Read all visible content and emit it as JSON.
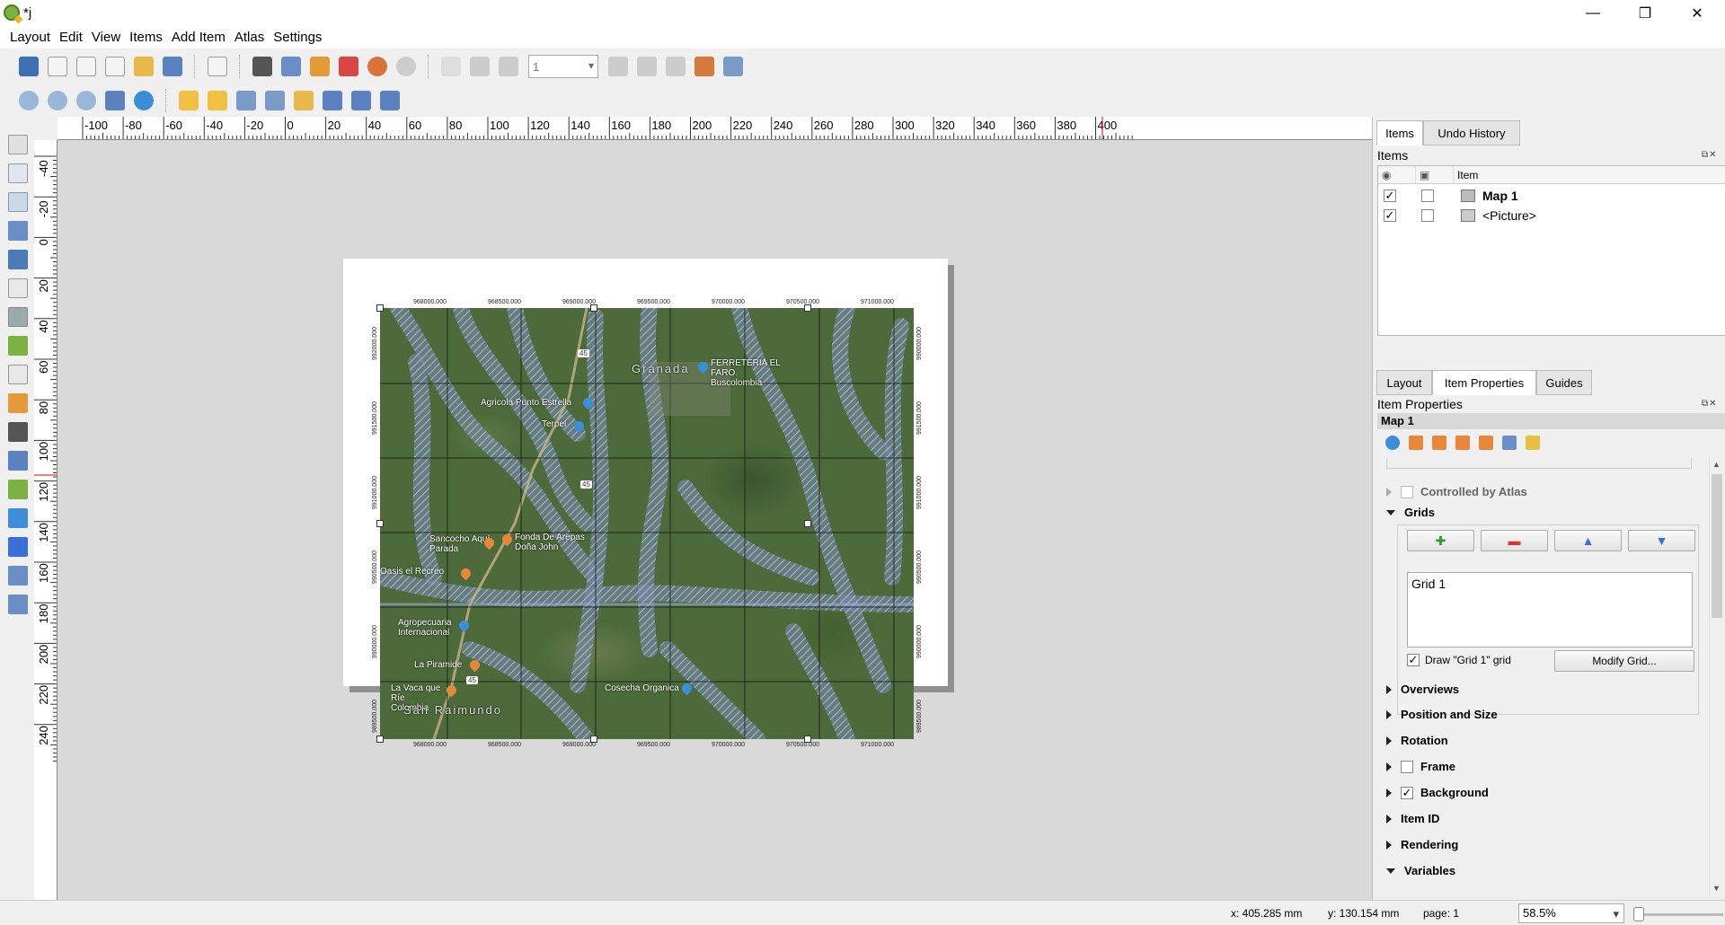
{
  "window": {
    "title": "*j",
    "minimize": "—",
    "maximize": "❐",
    "close": "✕"
  },
  "menu": [
    "Layout",
    "Edit",
    "View",
    "Items",
    "Add Item",
    "Atlas",
    "Settings"
  ],
  "toolbar": {
    "page_value": "1"
  },
  "ruler_top": [
    "-100",
    "-80",
    "-60",
    "-40",
    "-20",
    "0",
    "20",
    "40",
    "60",
    "80",
    "100",
    "120",
    "140",
    "160",
    "180",
    "200",
    "220",
    "240",
    "260",
    "280",
    "300",
    "320",
    "340",
    "360",
    "380",
    "400"
  ],
  "ruler_left": [
    "-40",
    "-20",
    "0",
    "20",
    "40",
    "60",
    "80",
    "100",
    "120",
    "140",
    "160",
    "180",
    "200",
    "220",
    "240"
  ],
  "map": {
    "top_coords": [
      "968000.000",
      "968500.000",
      "969000.000",
      "969500.000",
      "970000.000",
      "970500.000",
      "971000.000"
    ],
    "left_coords": [
      "992000.000",
      "991500.000",
      "991000.000",
      "990500.000",
      "990000.000",
      "989500.000"
    ],
    "right_coords": [
      "990000.000",
      "991500.000",
      "991000.000",
      "990500.000",
      "990000.000",
      "989500.000"
    ],
    "labels": {
      "granada": "Granada",
      "ferreteria": "FERRETERIA EL FARO. Buscolombia",
      "agricola": "Agricola Punto Estrella",
      "terpel": "Terpel",
      "sancocho": "Sancocho Aquí Parada",
      "arepas": "Fonda De Arepas Doña John",
      "recreo": "Oasis el Recreo",
      "agropecuaria": "Agropecuaria Internacional",
      "piramide": "La Piramide",
      "vaca": "La Vaca que Ríe Colombia",
      "cosecha": "Cosecha Organica",
      "sanraimundo": "San Raimundo",
      "road1": "45",
      "road2": "45",
      "road3": "45"
    }
  },
  "dock": {
    "tabs_top": [
      "Items",
      "Undo History"
    ],
    "items_title": "Items",
    "items_header_item": "Item",
    "items": [
      {
        "label": "Map 1",
        "visible": "✓"
      },
      {
        "label": "<Picture>",
        "visible": "✓"
      }
    ],
    "tabs_bottom": [
      "Layout",
      "Item Properties",
      "Guides"
    ],
    "props_title": "Item Properties",
    "props_item": "Map 1",
    "float_icons": "⧉✕",
    "sections": {
      "controlled": "Controlled by Atlas",
      "grids": "Grids",
      "grid_item": "Grid 1",
      "draw_grid": "Draw \"Grid 1\" grid",
      "modify_grid": "Modify Grid...",
      "overviews": "Overviews",
      "position": "Position and Size",
      "rotation": "Rotation",
      "frame": "Frame",
      "background": "Background",
      "item_id": "Item ID",
      "rendering": "Rendering",
      "variables": "Variables",
      "check": "✓"
    },
    "grid_buttons": {
      "add": "✚",
      "remove": "▬",
      "up": "▲",
      "down": "▼"
    }
  },
  "status": {
    "x": "x: 405.285 mm",
    "y": "y: 130.154 mm",
    "page": "page: 1",
    "zoom": "58.5%"
  },
  "colors": {
    "accent": "#3a6fd8",
    "selection": "#cbd8e6",
    "map_green": "#4c6a3a",
    "hatch": "#6e7fb0"
  }
}
